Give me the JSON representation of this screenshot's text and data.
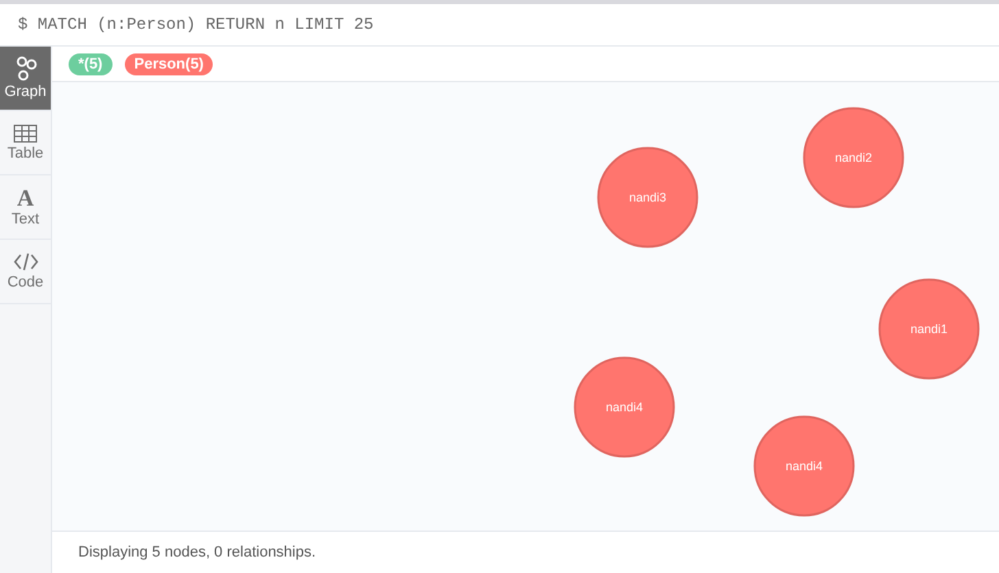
{
  "query": "$ MATCH (n:Person) RETURN n LIMIT 25",
  "sidebar": {
    "items": [
      {
        "kind": "graph",
        "label": "Graph",
        "selected": true
      },
      {
        "kind": "table",
        "label": "Table",
        "selected": false
      },
      {
        "kind": "text",
        "label": "Text",
        "glyph": "A",
        "selected": false
      },
      {
        "kind": "code",
        "label": "Code",
        "selected": false
      }
    ]
  },
  "legend": [
    {
      "label": "*(5)",
      "color": "#6dce9e"
    },
    {
      "label": "Person(5)",
      "color": "#ff756e"
    }
  ],
  "nodes": [
    {
      "label": "nandi3"
    },
    {
      "label": "nandi2"
    },
    {
      "label": "nandi1"
    },
    {
      "label": "nandi4"
    },
    {
      "label": "nandi4"
    }
  ],
  "status": "Displaying 5 nodes, 0 relationships."
}
